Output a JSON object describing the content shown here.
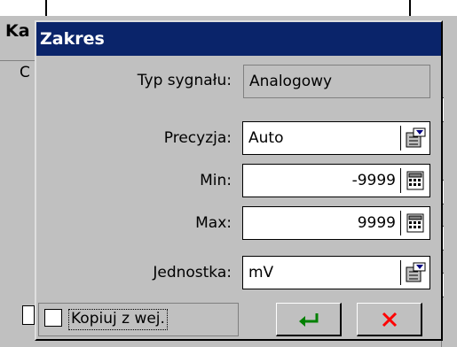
{
  "background_window": {
    "title": "Ka",
    "label": "C"
  },
  "dialog": {
    "title": "Zakres",
    "signal_type": {
      "label": "Typ sygnału:",
      "value": "Analogowy"
    },
    "precision": {
      "label": "Precyzja:",
      "value": "Auto",
      "icon": "dropdown-list-icon"
    },
    "min": {
      "label": "Min:",
      "value": "-9999",
      "icon": "calculator-icon"
    },
    "max": {
      "label": "Max:",
      "value": "9999",
      "icon": "calculator-icon"
    },
    "unit": {
      "label": "Jednostka:",
      "value": "mV",
      "icon": "dropdown-list-icon"
    },
    "copy_checkbox": {
      "label": "Kopiuj z wej.",
      "checked": false
    },
    "ok_button": {
      "icon": "enter-arrow-icon",
      "color": "#008000"
    },
    "cancel_button": {
      "icon": "close-x-icon",
      "color": "#ff0000"
    }
  },
  "colors": {
    "title_bar": "#0a246a",
    "face": "#c0c0c0"
  }
}
